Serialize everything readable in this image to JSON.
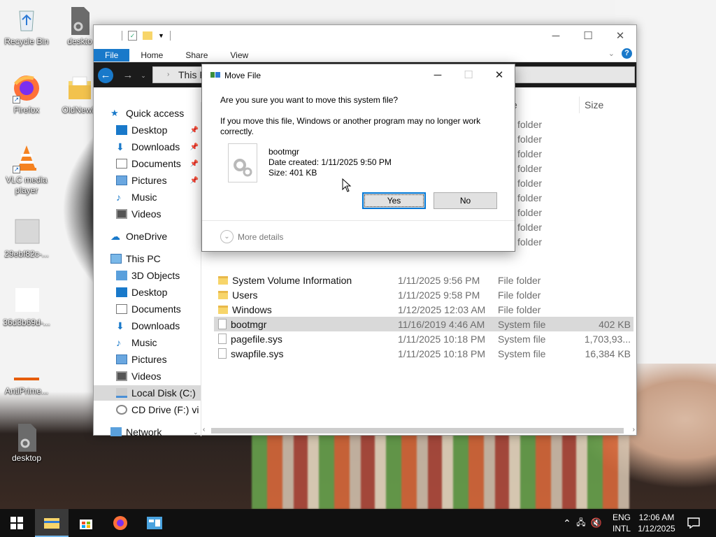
{
  "desktop": {
    "icons": [
      {
        "label": "Recycle Bin",
        "icon": "recycle-bin-icon"
      },
      {
        "label": "deskto",
        "icon": "settings-file-icon"
      },
      {
        "label": "Firefox",
        "icon": "firefox-icon"
      },
      {
        "label": "OldNewE",
        "icon": "folder-icon"
      },
      {
        "label": "VLC media player",
        "icon": "vlc-icon"
      },
      {
        "label": "29ebf82c-...",
        "icon": "blank-file-icon"
      },
      {
        "label": "36d3b69d-...",
        "icon": "white-file-icon"
      },
      {
        "label": "AntiPrime...",
        "icon": "antiprime-icon"
      },
      {
        "label": "desktop",
        "icon": "settings-file-icon"
      }
    ]
  },
  "explorer": {
    "ribbon_tabs": [
      "File",
      "Home",
      "Share",
      "View"
    ],
    "address_text": "This P",
    "columns": {
      "type_partial": "e",
      "size": "Size"
    },
    "nav": {
      "quick_access": "Quick access",
      "quick_items": [
        "Desktop",
        "Downloads",
        "Documents",
        "Pictures",
        "Music",
        "Videos"
      ],
      "onedrive": "OneDrive",
      "this_pc": "This PC",
      "pc_items": [
        "3D Objects",
        "Desktop",
        "Documents",
        "Downloads",
        "Music",
        "Pictures",
        "Videos",
        "Local Disk (C:)",
        "CD Drive (F:) vi"
      ],
      "network": "Network"
    },
    "hidden_rows_type": [
      "folder",
      "folder",
      "folder",
      "folder",
      "folder",
      "folder",
      "folder",
      "folder",
      "folder"
    ],
    "rows": [
      {
        "name": "System Volume Information",
        "date": "1/11/2025 9:56 PM",
        "type": "File folder",
        "size": "",
        "kind": "folder"
      },
      {
        "name": "Users",
        "date": "1/11/2025 9:58 PM",
        "type": "File folder",
        "size": "",
        "kind": "folder"
      },
      {
        "name": "Windows",
        "date": "1/12/2025 12:03 AM",
        "type": "File folder",
        "size": "",
        "kind": "folder"
      },
      {
        "name": "bootmgr",
        "date": "11/16/2019 4:46 AM",
        "type": "System file",
        "size": "402 KB",
        "kind": "file"
      },
      {
        "name": "pagefile.sys",
        "date": "1/11/2025 10:18 PM",
        "type": "System file",
        "size": "1,703,93...",
        "kind": "file"
      },
      {
        "name": "swapfile.sys",
        "date": "1/11/2025 10:18 PM",
        "type": "System file",
        "size": "16,384 KB",
        "kind": "file"
      }
    ]
  },
  "dialog": {
    "title": "Move File",
    "question": "Are you sure you want to move this system file?",
    "warning": "If you move this file, Windows or another program may no longer work correctly.",
    "file_name": "bootmgr",
    "date_created": "Date created: 1/11/2025 9:50 PM",
    "size": "Size: 401 KB",
    "yes": "Yes",
    "no": "No",
    "more_details": "More details"
  },
  "taskbar": {
    "lang_top": "ENG",
    "lang_bottom": "INTL",
    "time": "12:06 AM",
    "date": "1/12/2025"
  },
  "colors": {
    "accent": "#0078d7",
    "file_tab": "#1979ca",
    "taskbar": "#101010"
  }
}
